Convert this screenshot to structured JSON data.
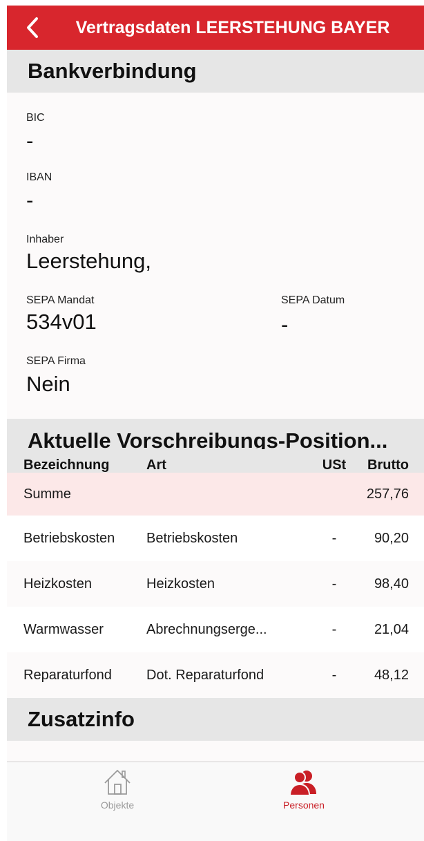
{
  "header": {
    "title": "Vertragsdaten LEERSTEHUNG BAYER",
    "back_icon": "chevron-left-icon"
  },
  "bank": {
    "section_title": "Bankverbindung",
    "bic_label": "BIC",
    "bic_value": "-",
    "iban_label": "IBAN",
    "iban_value": "-",
    "holder_label": "Inhaber",
    "holder_value": "Leerstehung,",
    "sepa_mandate_label": "SEPA Mandat",
    "sepa_mandate_value": "534v01",
    "sepa_date_label": "SEPA Datum",
    "sepa_date_value": "-",
    "sepa_company_label": "SEPA Firma",
    "sepa_company_value": "Nein"
  },
  "positions": {
    "section_title": "Aktuelle Vorschreibungs-Position...",
    "columns": {
      "name": "Bezeichnung",
      "art": "Art",
      "ust": "USt",
      "brutto": "Brutto"
    },
    "rows": [
      {
        "name": "Summe",
        "art": "",
        "ust": "",
        "brutto": "257,76"
      },
      {
        "name": "Betriebskosten",
        "art": "Betriebskosten",
        "ust": "-",
        "brutto": "90,20"
      },
      {
        "name": "Heizkosten",
        "art": "Heizkosten",
        "ust": "-",
        "brutto": "98,40"
      },
      {
        "name": "Warmwasser",
        "art": "Abrechnungserge...",
        "ust": "-",
        "brutto": "21,04"
      },
      {
        "name": "Reparaturfond",
        "art": "Dot. Reparaturfond",
        "ust": "-",
        "brutto": "48,12"
      }
    ]
  },
  "extra": {
    "section_title": "Zusatzinfo"
  },
  "tabbar": {
    "tabs": [
      {
        "label": "Objekte",
        "icon": "house-icon",
        "active": false
      },
      {
        "label": "Personen",
        "icon": "people-icon",
        "active": true
      }
    ]
  },
  "colors": {
    "brand_red": "#d8262d",
    "section_grey": "#e6e6e6",
    "summary_row": "#fce8e8",
    "inactive_tab": "#9a9a9a",
    "active_tab": "#c91f26"
  }
}
